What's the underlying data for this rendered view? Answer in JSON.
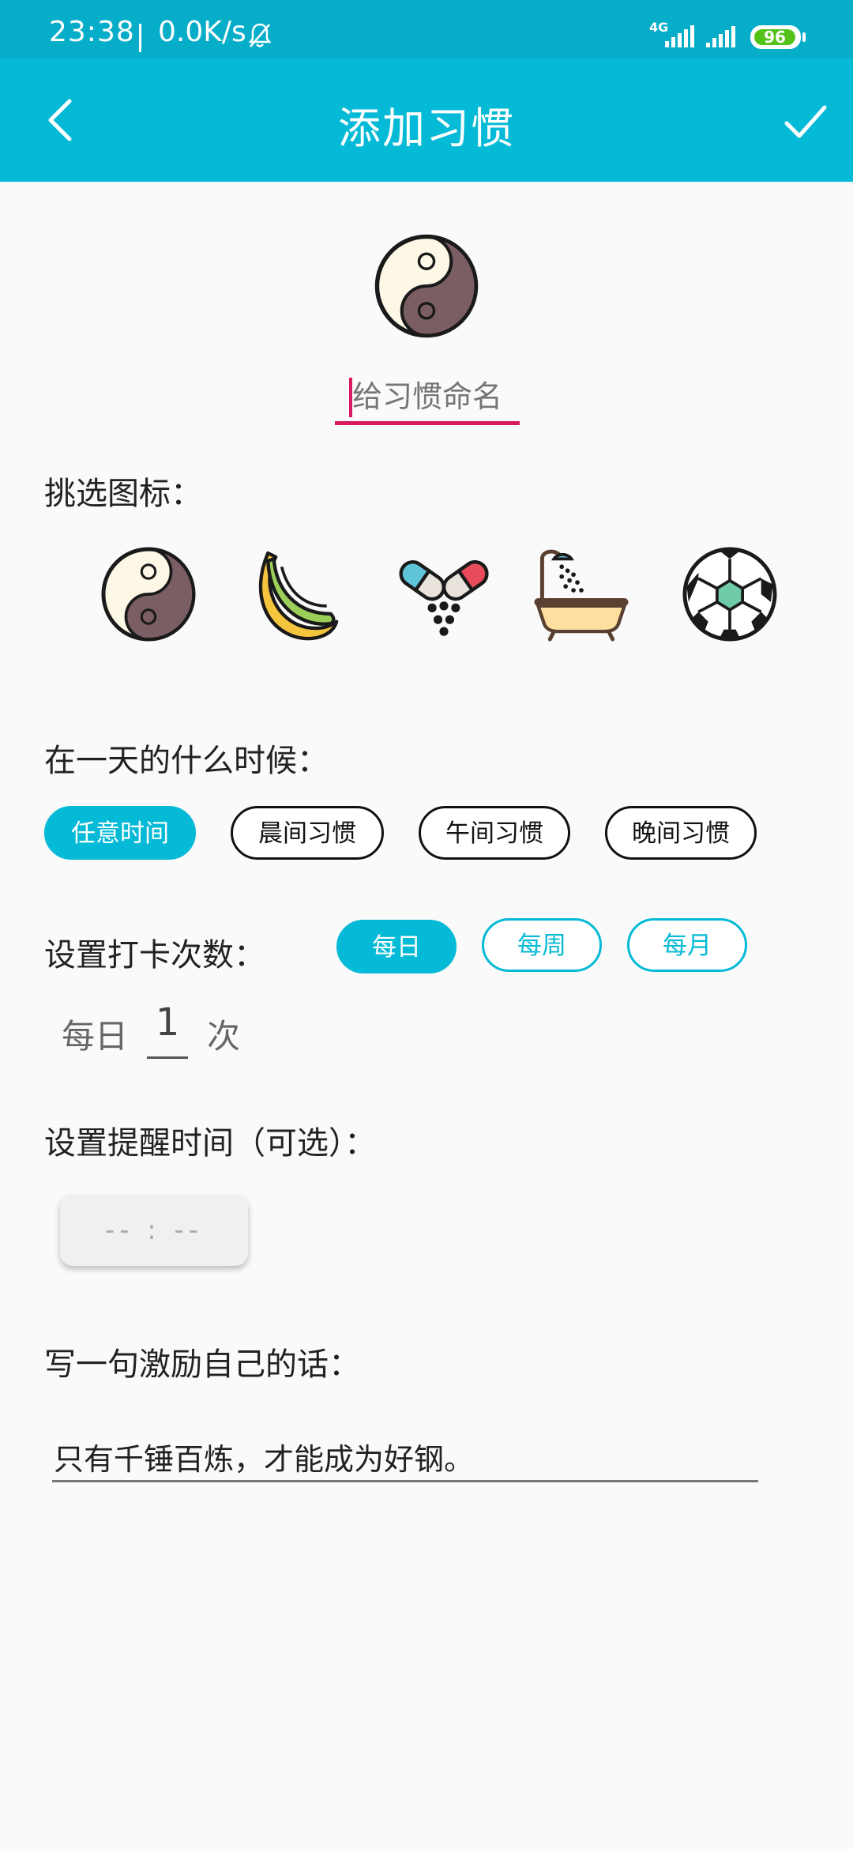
{
  "status_bar": {
    "time": "23:38",
    "speed": "0.0K/s",
    "network": "4G",
    "battery": "96"
  },
  "app_bar": {
    "title": "添加习惯",
    "back_icon": "chevron-left-icon",
    "confirm_icon": "check-icon"
  },
  "habit": {
    "selected_icon": "yin-yang-icon",
    "name_placeholder": "给习惯命名",
    "name_value": ""
  },
  "icon_picker": {
    "label": "挑选图标：",
    "icons": [
      "yin-yang-icon",
      "banana-icon",
      "pills-icon",
      "bathtub-icon",
      "soccer-ball-icon"
    ]
  },
  "time_of_day": {
    "label": "在一天的什么时候：",
    "options": [
      "任意时间",
      "晨间习惯",
      "午间习惯",
      "晚间习惯"
    ],
    "selected": 0
  },
  "checkin": {
    "label": "设置打卡次数：",
    "periods": [
      "每日",
      "每周",
      "每月"
    ],
    "selected": 0,
    "count_prefix": "每日",
    "count_value": "1",
    "count_suffix": "次"
  },
  "reminder": {
    "label": "设置提醒时间（可选）：",
    "time_text": "--  :  --"
  },
  "motto": {
    "label": "写一句激励自己的话：",
    "value": "只有千锤百炼，才能成为好钢。"
  },
  "colors": {
    "primary": "#05bad6",
    "status_bar": "#05adc8",
    "accent": "#d81b60"
  }
}
